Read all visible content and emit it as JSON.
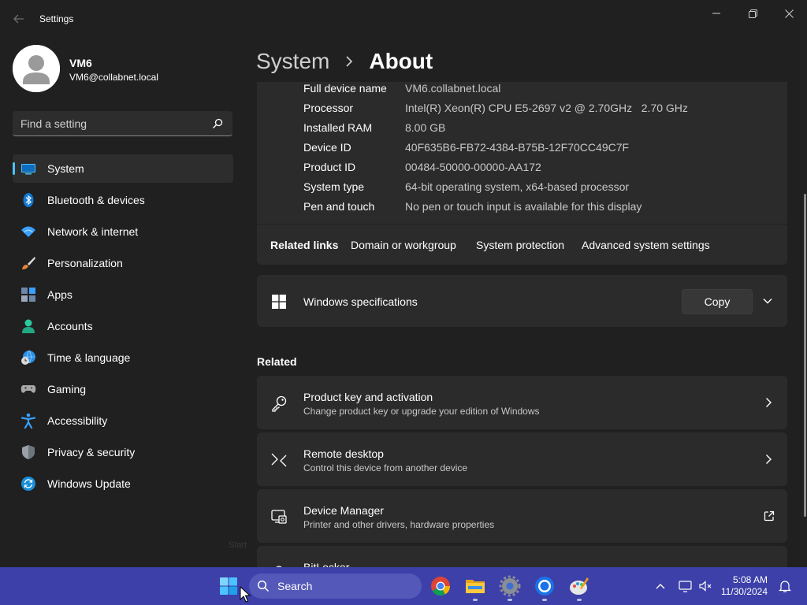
{
  "window": {
    "title": "Settings",
    "controls": {
      "minimize_icon": "minimize-icon",
      "maximize_icon": "restore-icon",
      "close_icon": "close-icon"
    }
  },
  "user": {
    "name": "VM6",
    "email": "VM6@collabnet.local"
  },
  "search": {
    "placeholder": "Find a setting"
  },
  "sidebar": {
    "items": [
      {
        "label": "System",
        "icon": "system-icon",
        "active": true
      },
      {
        "label": "Bluetooth & devices",
        "icon": "bluetooth-icon"
      },
      {
        "label": "Network & internet",
        "icon": "wifi-icon"
      },
      {
        "label": "Personalization",
        "icon": "brush-icon"
      },
      {
        "label": "Apps",
        "icon": "apps-icon"
      },
      {
        "label": "Accounts",
        "icon": "account-icon"
      },
      {
        "label": "Time & language",
        "icon": "globe-clock-icon"
      },
      {
        "label": "Gaming",
        "icon": "gamepad-icon"
      },
      {
        "label": "Accessibility",
        "icon": "accessibility-icon"
      },
      {
        "label": "Privacy & security",
        "icon": "shield-icon"
      },
      {
        "label": "Windows Update",
        "icon": "update-icon"
      }
    ],
    "ghost_text": "Start"
  },
  "breadcrumb": {
    "parent": "System",
    "current": "About"
  },
  "device_specs": [
    {
      "label": "Full device name",
      "value": "VM6.collabnet.local"
    },
    {
      "label": "Processor",
      "value": "Intel(R) Xeon(R) CPU E5-2697 v2 @ 2.70GHz   2.70 GHz"
    },
    {
      "label": "Installed RAM",
      "value": "8.00 GB"
    },
    {
      "label": "Device ID",
      "value": "40F635B6-FB72-4384-B75B-12F70CC49C7F"
    },
    {
      "label": "Product ID",
      "value": "00484-50000-00000-AA172"
    },
    {
      "label": "System type",
      "value": "64-bit operating system, x64-based processor"
    },
    {
      "label": "Pen and touch",
      "value": "No pen or touch input is available for this display"
    }
  ],
  "related_links": {
    "title": "Related links",
    "links": [
      "Domain or workgroup",
      "System protection",
      "Advanced system settings"
    ]
  },
  "windows_specs": {
    "title": "Windows specifications",
    "copy_label": "Copy",
    "icon": "windows-logo-icon"
  },
  "related": {
    "title": "Related",
    "items": [
      {
        "title": "Product key and activation",
        "subtitle": "Change product key or upgrade your edition of Windows",
        "icon": "key-icon",
        "action_icon": "chevron-right-icon"
      },
      {
        "title": "Remote desktop",
        "subtitle": "Control this device from another device",
        "icon": "remote-desktop-icon",
        "action_icon": "chevron-right-icon"
      },
      {
        "title": "Device Manager",
        "subtitle": "Printer and other drivers, hardware properties",
        "icon": "device-manager-icon",
        "action_icon": "external-link-icon"
      },
      {
        "title": "BitLocker",
        "subtitle": "",
        "icon": "bitlocker-icon",
        "action_icon": "chevron-right-icon"
      }
    ]
  },
  "taskbar": {
    "search_label": "Search",
    "apps": [
      "chrome-icon",
      "file-explorer-icon",
      "settings-gear-icon",
      "browser-icon",
      "paint-icon"
    ],
    "time": "5:08 AM",
    "date": "11/30/2024"
  },
  "colors": {
    "accent": "#4cc2ff",
    "background": "#202020",
    "card": "#2b2b2b",
    "taskbar": "#3c40a8"
  }
}
